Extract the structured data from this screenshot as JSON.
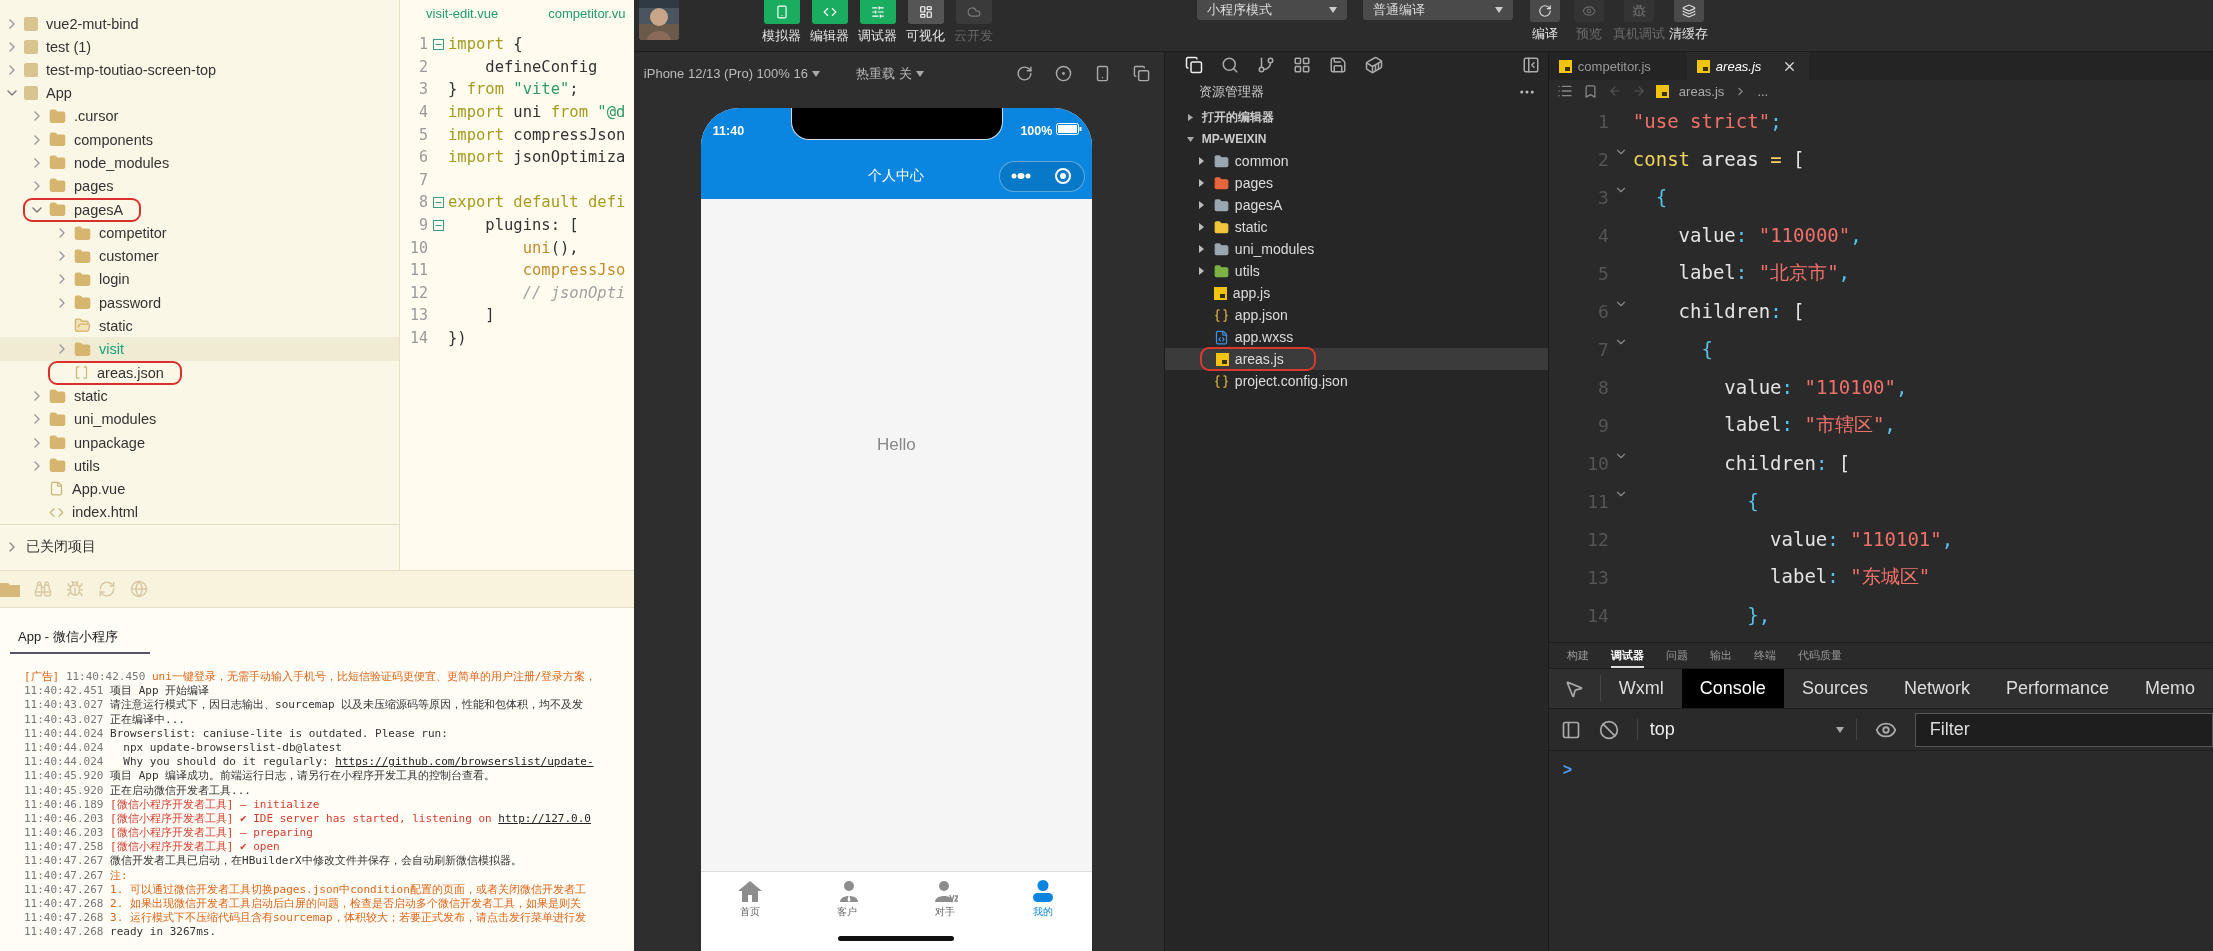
{
  "hbuilder": {
    "project_tree": [
      {
        "label": "vue2-mut-bind",
        "kind": "project",
        "expanded": false,
        "selected": false,
        "circled": false
      },
      {
        "label": "test (1)",
        "kind": "project",
        "expanded": false,
        "selected": false,
        "circled": false
      },
      {
        "label": "test-mp-toutiao-screen-top",
        "kind": "project",
        "expanded": false,
        "selected": false,
        "circled": false
      },
      {
        "label": "App",
        "kind": "project",
        "expanded": true,
        "selected": false,
        "circled": false,
        "children": [
          {
            "label": ".cursor",
            "kind": "folder",
            "expanded": false,
            "selected": false,
            "circled": false
          },
          {
            "label": "components",
            "kind": "folder",
            "expanded": false,
            "selected": false,
            "circled": false
          },
          {
            "label": "node_modules",
            "kind": "folder",
            "expanded": false,
            "selected": false,
            "circled": false
          },
          {
            "label": "pages",
            "kind": "folder",
            "expanded": false,
            "selected": false,
            "circled": false
          },
          {
            "label": "pagesA",
            "kind": "folder",
            "expanded": true,
            "selected": false,
            "circled": true,
            "children": [
              {
                "label": "competitor",
                "kind": "folder",
                "expanded": false,
                "selected": false,
                "circled": false
              },
              {
                "label": "customer",
                "kind": "folder",
                "expanded": false,
                "selected": false,
                "circled": false
              },
              {
                "label": "login",
                "kind": "folder",
                "expanded": false,
                "selected": false,
                "circled": false
              },
              {
                "label": "password",
                "kind": "folder",
                "expanded": false,
                "selected": false,
                "circled": false
              },
              {
                "label": "static",
                "kind": "empty-folder",
                "selected": false,
                "circled": false
              },
              {
                "label": "visit",
                "kind": "folder",
                "expanded": false,
                "selected": true,
                "circled": false
              },
              {
                "label": "areas.json",
                "kind": "json-file",
                "selected": false,
                "circled": true
              }
            ]
          },
          {
            "label": "static",
            "kind": "folder",
            "expanded": false,
            "selected": false,
            "circled": false
          },
          {
            "label": "uni_modules",
            "kind": "folder",
            "expanded": false,
            "selected": false,
            "circled": false
          },
          {
            "label": "unpackage",
            "kind": "folder",
            "expanded": false,
            "selected": false,
            "circled": false
          },
          {
            "label": "utils",
            "kind": "folder",
            "expanded": false,
            "selected": false,
            "circled": false
          },
          {
            "label": "App.vue",
            "kind": "vue-file",
            "selected": false,
            "circled": false
          },
          {
            "label": "index.html",
            "kind": "html-file",
            "selected": false,
            "circled": false
          }
        ]
      }
    ],
    "closed_projects": "已关闭项目",
    "editor": {
      "tabs": [
        "visit-edit.vue",
        "competitor.vu"
      ],
      "lines": [
        {
          "number": "1",
          "fold": true,
          "tokens": [
            {
              "t": "import",
              "kind": "kw"
            },
            {
              "t": " {",
              "kind": "plain"
            }
          ]
        },
        {
          "number": "2",
          "fold": false,
          "tokens": [
            {
              "t": "    defineConfig",
              "kind": "plain"
            }
          ]
        },
        {
          "number": "3",
          "fold": false,
          "tokens": [
            {
              "t": "} ",
              "kind": "plain"
            },
            {
              "t": "from ",
              "kind": "kw"
            },
            {
              "t": "\"vite\"",
              "kind": "str"
            },
            {
              "t": ";",
              "kind": "plain"
            }
          ]
        },
        {
          "number": "4",
          "fold": false,
          "tokens": [
            {
              "t": "import",
              "kind": "kw"
            },
            {
              "t": " uni ",
              "kind": "plain"
            },
            {
              "t": "from ",
              "kind": "kw"
            },
            {
              "t": "\"@d",
              "kind": "str"
            }
          ]
        },
        {
          "number": "5",
          "fold": false,
          "tokens": [
            {
              "t": "import",
              "kind": "kw"
            },
            {
              "t": " compressJson",
              "kind": "plain"
            }
          ]
        },
        {
          "number": "6",
          "fold": false,
          "tokens": [
            {
              "t": "import",
              "kind": "kw"
            },
            {
              "t": " jsonOptimiza",
              "kind": "plain"
            }
          ]
        },
        {
          "number": "7",
          "fold": false
        },
        {
          "number": "8",
          "fold": true,
          "tokens": [
            {
              "t": "export default defi",
              "kind": "kw"
            }
          ]
        },
        {
          "number": "9",
          "fold": true,
          "tokens": [
            {
              "t": "    plugins: [",
              "kind": "plain"
            }
          ]
        },
        {
          "number": "10",
          "fold": false,
          "tokens": [
            {
              "t": "        uni",
              "kind": "fn"
            },
            {
              "t": "(),",
              "kind": "plain"
            }
          ]
        },
        {
          "number": "11",
          "fold": false,
          "tokens": [
            {
              "t": "        compressJso",
              "kind": "fn"
            }
          ]
        },
        {
          "number": "12",
          "fold": false,
          "tokens": [
            {
              "t": "        // jsonOpti",
              "kind": "cmt"
            }
          ]
        },
        {
          "number": "13",
          "fold": false,
          "tokens": [
            {
              "t": "    ]",
              "kind": "plain"
            }
          ]
        },
        {
          "number": "14",
          "fold": false,
          "tokens": [
            {
              "t": "})",
              "kind": "plain"
            }
          ]
        }
      ]
    },
    "console": {
      "tab": "App - 微信小程序",
      "lines": [
        {
          "prefix": "[广告]",
          "time": "11:40:42.450",
          "text": "uni一键登录，无需手动输入手机号，比短信验证码更便宜、更简单的用户注册/登录方案，",
          "kind": "ad"
        },
        {
          "time": "11:40:42.451",
          "text": "项目 App 开始编译",
          "kind": "info"
        },
        {
          "time": "11:40:43.027",
          "text": "请注意运行模式下，因日志输出、sourcemap 以及未压缩源码等原因，性能和包体积，均不及发",
          "kind": "info"
        },
        {
          "time": "11:40:43.027",
          "text": "正在编译中...",
          "kind": "info"
        },
        {
          "time": "11:40:44.024",
          "text": "Browserslist: caniuse-lite is outdated. Please run:",
          "kind": "info"
        },
        {
          "time": "11:40:44.024",
          "text": "  npx update-browserslist-db@latest",
          "kind": "info"
        },
        {
          "time": "11:40:44.024",
          "text": "  Why you should do it regularly: ",
          "link": "https://github.com/browserslist/update-",
          "kind": "info"
        },
        {
          "time": "11:40:45.920",
          "text": "项目 App 编译成功。前端运行日志，请另行在小程序开发工具的控制台查看。",
          "kind": "info"
        },
        {
          "time": "11:40:45.920",
          "text": "正在启动微信开发者工具...",
          "kind": "info"
        },
        {
          "time": "11:40:46.189",
          "text": "[微信小程序开发者工具] – initialize",
          "kind": "tool"
        },
        {
          "time": "11:40:46.203",
          "text": "[微信小程序开发者工具] ✔ IDE server has started, listening on ",
          "link": "http://127.0.0",
          "kind": "tool"
        },
        {
          "time": "11:40:46.203",
          "text": "[微信小程序开发者工具] – preparing",
          "kind": "tool"
        },
        {
          "time": "11:40:47.258",
          "text": "[微信小程序开发者工具] ✔ open",
          "kind": "tool"
        },
        {
          "time": "11:40:47.267",
          "text": "微信开发者工具已启动，在HBuilderX中修改文件并保存，会自动刷新微信模拟器。",
          "kind": "info"
        },
        {
          "time": "11:40:47.267",
          "text": "注:",
          "kind": "note"
        },
        {
          "time": "11:40:47.267",
          "text": "1. 可以通过微信开发者工具切换pages.json中condition配置的页面，或者关闭微信开发者工",
          "kind": "note"
        },
        {
          "time": "11:40:47.268",
          "text": "2. 如果出现微信开发者工具启动后白屏的问题，检查是否启动多个微信开发者工具，如果是则关",
          "kind": "note"
        },
        {
          "time": "11:40:47.268",
          "text": "3. 运行模式下不压缩代码且含有sourcemap，体积较大；若要正式发布，请点击发行菜单进行发",
          "kind": "note"
        },
        {
          "time": "11:40:47.268",
          "text": "ready in 3267ms.",
          "kind": "info"
        }
      ]
    }
  },
  "devtools": {
    "toolbar": {
      "left_buttons": [
        {
          "label": "模拟器",
          "kind": "phone",
          "on": true,
          "disabled": false
        },
        {
          "label": "编辑器",
          "kind": "code",
          "on": true,
          "disabled": false
        },
        {
          "label": "调试器",
          "kind": "sliders",
          "on": true,
          "disabled": false
        },
        {
          "label": "可视化",
          "kind": "layout",
          "on": false,
          "disabled": false
        },
        {
          "label": "云开发",
          "kind": "cloud",
          "on": false,
          "disabled": true
        }
      ],
      "mode_select": "小程序模式",
      "compile_select": "普通编译",
      "right_buttons": [
        {
          "label": "编译",
          "kind": "refresh",
          "disabled": false
        },
        {
          "label": "预览",
          "kind": "eye",
          "disabled": true
        },
        {
          "label": "真机调试",
          "kind": "bug",
          "disabled": true
        },
        {
          "label": "清缓存",
          "kind": "layers",
          "disabled": false
        }
      ]
    },
    "simulator": {
      "device": "iPhone 12/13 (Pro) 100% 16",
      "hot_reload": "热重载 关",
      "phone": {
        "time": "11:40",
        "battery": "100%",
        "title": "个人中心",
        "body": "Hello",
        "tabs": [
          {
            "label": "首页",
            "kind": "home",
            "selected": false
          },
          {
            "label": "客户",
            "kind": "customer",
            "selected": false
          },
          {
            "label": "对手",
            "kind": "rival",
            "selected": false
          },
          {
            "label": "我的",
            "kind": "me",
            "selected": true
          }
        ]
      }
    },
    "explorer": {
      "title": "资源管理器",
      "sections": [
        {
          "label": "打开的编辑器",
          "expanded": false
        },
        {
          "label": "MP-WEIXIN",
          "expanded": true
        }
      ],
      "items": [
        {
          "label": "common",
          "kind": "folder",
          "color": "#9aa7b0",
          "expanded": false,
          "selected": false,
          "circled": false
        },
        {
          "label": "pages",
          "kind": "folder",
          "color": "#e8643c",
          "expanded": false,
          "selected": false,
          "circled": false
        },
        {
          "label": "pagesA",
          "kind": "folder",
          "color": "#9aa7b0",
          "expanded": false,
          "selected": false,
          "circled": false
        },
        {
          "label": "static",
          "kind": "folder",
          "color": "#f2c53d",
          "expanded": false,
          "selected": false,
          "circled": false
        },
        {
          "label": "uni_modules",
          "kind": "folder",
          "color": "#9aa7b0",
          "expanded": false,
          "selected": false,
          "circled": false
        },
        {
          "label": "utils",
          "kind": "folder",
          "color": "#7cb342",
          "expanded": false,
          "selected": false,
          "circled": false
        },
        {
          "label": "app.js",
          "kind": "js",
          "selected": false,
          "circled": false
        },
        {
          "label": "app.json",
          "kind": "json",
          "selected": false,
          "circled": false
        },
        {
          "label": "app.wxss",
          "kind": "wxss",
          "selected": false,
          "circled": false
        },
        {
          "label": "areas.js",
          "kind": "js",
          "selected": true,
          "circled": true
        },
        {
          "label": "project.config.json",
          "kind": "json",
          "selected": false,
          "circled": false
        }
      ]
    },
    "editor": {
      "tabs": [
        {
          "label": "competitor.js",
          "selected": false
        },
        {
          "label": "areas.js",
          "selected": true
        }
      ],
      "breadcrumb": "areas.js",
      "breadcrumb_more": "...",
      "lines": [
        {
          "number": "1",
          "fold": false,
          "tokens": [
            {
              "t": "\"use strict\"",
              "kind": "str"
            },
            {
              "t": ";",
              "kind": "punc"
            }
          ]
        },
        {
          "number": "2",
          "fold": true,
          "tokens": [
            {
              "t": "const",
              "kind": "kw"
            },
            {
              "t": " areas ",
              "kind": "plain"
            },
            {
              "t": "=",
              "kind": "kw"
            },
            {
              "t": " [",
              "kind": "plain"
            }
          ]
        },
        {
          "number": "3",
          "fold": true,
          "tokens": [
            {
              "t": "  {",
              "kind": "punc"
            }
          ]
        },
        {
          "number": "4",
          "fold": false,
          "tokens": [
            {
              "t": "    value",
              "kind": "plain"
            },
            {
              "t": ": ",
              "kind": "punc"
            },
            {
              "t": "\"110000\"",
              "kind": "str"
            },
            {
              "t": ",",
              "kind": "punc"
            }
          ]
        },
        {
          "number": "5",
          "fold": false,
          "tokens": [
            {
              "t": "    label",
              "kind": "plain"
            },
            {
              "t": ": ",
              "kind": "punc"
            },
            {
              "t": "\"北京市\"",
              "kind": "str"
            },
            {
              "t": ",",
              "kind": "punc"
            }
          ]
        },
        {
          "number": "6",
          "fold": true,
          "tokens": [
            {
              "t": "    children",
              "kind": "plain"
            },
            {
              "t": ": ",
              "kind": "punc"
            },
            {
              "t": "[",
              "kind": "plain"
            }
          ]
        },
        {
          "number": "7",
          "fold": true,
          "tokens": [
            {
              "t": "      {",
              "kind": "punc"
            }
          ]
        },
        {
          "number": "8",
          "fold": false,
          "tokens": [
            {
              "t": "        value",
              "kind": "plain"
            },
            {
              "t": ": ",
              "kind": "punc"
            },
            {
              "t": "\"110100\"",
              "kind": "str"
            },
            {
              "t": ",",
              "kind": "punc"
            }
          ]
        },
        {
          "number": "9",
          "fold": false,
          "tokens": [
            {
              "t": "        label",
              "kind": "plain"
            },
            {
              "t": ": ",
              "kind": "punc"
            },
            {
              "t": "\"市辖区\"",
              "kind": "str"
            },
            {
              "t": ",",
              "kind": "punc"
            }
          ]
        },
        {
          "number": "10",
          "fold": true,
          "tokens": [
            {
              "t": "        children",
              "kind": "plain"
            },
            {
              "t": ": ",
              "kind": "punc"
            },
            {
              "t": "[",
              "kind": "plain"
            }
          ]
        },
        {
          "number": "11",
          "fold": true,
          "tokens": [
            {
              "t": "          {",
              "kind": "punc"
            }
          ]
        },
        {
          "number": "12",
          "fold": false,
          "tokens": [
            {
              "t": "            value",
              "kind": "plain"
            },
            {
              "t": ": ",
              "kind": "punc"
            },
            {
              "t": "\"110101\"",
              "kind": "str"
            },
            {
              "t": ",",
              "kind": "punc"
            }
          ]
        },
        {
          "number": "13",
          "fold": false,
          "tokens": [
            {
              "t": "            label",
              "kind": "plain"
            },
            {
              "t": ": ",
              "kind": "punc"
            },
            {
              "t": "\"东城区\"",
              "kind": "str"
            }
          ]
        },
        {
          "number": "14",
          "fold": false,
          "tokens": [
            {
              "t": "          },",
              "kind": "punc"
            }
          ]
        }
      ]
    },
    "panel": {
      "tabs": [
        {
          "label": "构建",
          "selected": false
        },
        {
          "label": "调试器",
          "selected": true
        },
        {
          "label": "问题",
          "selected": false
        },
        {
          "label": "输出",
          "selected": false
        },
        {
          "label": "终端",
          "selected": false
        },
        {
          "label": "代码质量",
          "selected": false
        }
      ],
      "devtools_tabs": [
        {
          "label": "Wxml",
          "selected": false
        },
        {
          "label": "Console",
          "selected": true
        },
        {
          "label": "Sources",
          "selected": false
        },
        {
          "label": "Network",
          "selected": false
        },
        {
          "label": "Performance",
          "selected": false
        },
        {
          "label": "Memo",
          "selected": false
        }
      ],
      "context": "top",
      "filter_placeholder": "Filter",
      "prompt": ">"
    }
  }
}
